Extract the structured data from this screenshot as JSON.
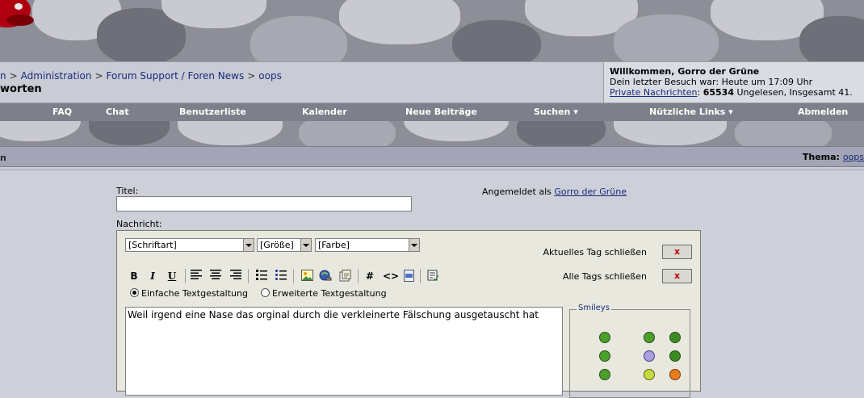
{
  "breadcrumb": {
    "items": [
      "n",
      "Administration",
      "Forum Support / Foren News",
      "oops"
    ],
    "page_title": "worten"
  },
  "welcome": {
    "greeting": "Willkommen, Gorro der Grüne",
    "last_visit": "Dein letzter Besuch war: Heute um 17:09 Uhr",
    "pm_label": "Private Nachrichten",
    "pm_colon": ":",
    "pm_unread_count": "65534",
    "pm_rest": "Ungelesen, Insgesamt 41."
  },
  "nav": {
    "faq": "FAQ",
    "chat": "Chat",
    "memberlist": "Benutzerliste",
    "calendar": "Kalender",
    "new_posts": "Neue Beiträge",
    "search": "Suchen ▾",
    "useful_links": "Nützliche Links ▾",
    "logout": "Abmelden"
  },
  "subbar": {
    "left": "n",
    "thema_label": "Thema:",
    "thema_value": "oops"
  },
  "form": {
    "title_label": "Titel:",
    "title_value": "",
    "logged_in_prefix": "Angemeldet als",
    "logged_in_user": "Gorro der Grüne",
    "message_label": "Nachricht:"
  },
  "editor": {
    "font_select": "[Schriftart]",
    "size_select": "[Größe]",
    "color_select": "[Farbe]",
    "close_current_tag": "Aktuelles Tag schließen",
    "close_all_tags": "Alle Tags schließen",
    "x_label": "x",
    "mode_simple": "Einfache Textgestaltung",
    "mode_advanced": "Erweiterte Textgestaltung",
    "message_text": "Weil irgend eine Nase das orginal durch die verkleinerte Fälschung ausgetauscht hat",
    "smileys_legend": "Smileys",
    "tools": {
      "bold": "B",
      "italic": "I",
      "underline": "U",
      "hash": "#",
      "code": "<>"
    }
  },
  "colors": {
    "banner": "#8d8e97",
    "navbar": "#7d7f8a",
    "link": "#1a2b7a",
    "editor_bg": "#e8e8df",
    "close_x": "#c00000"
  }
}
